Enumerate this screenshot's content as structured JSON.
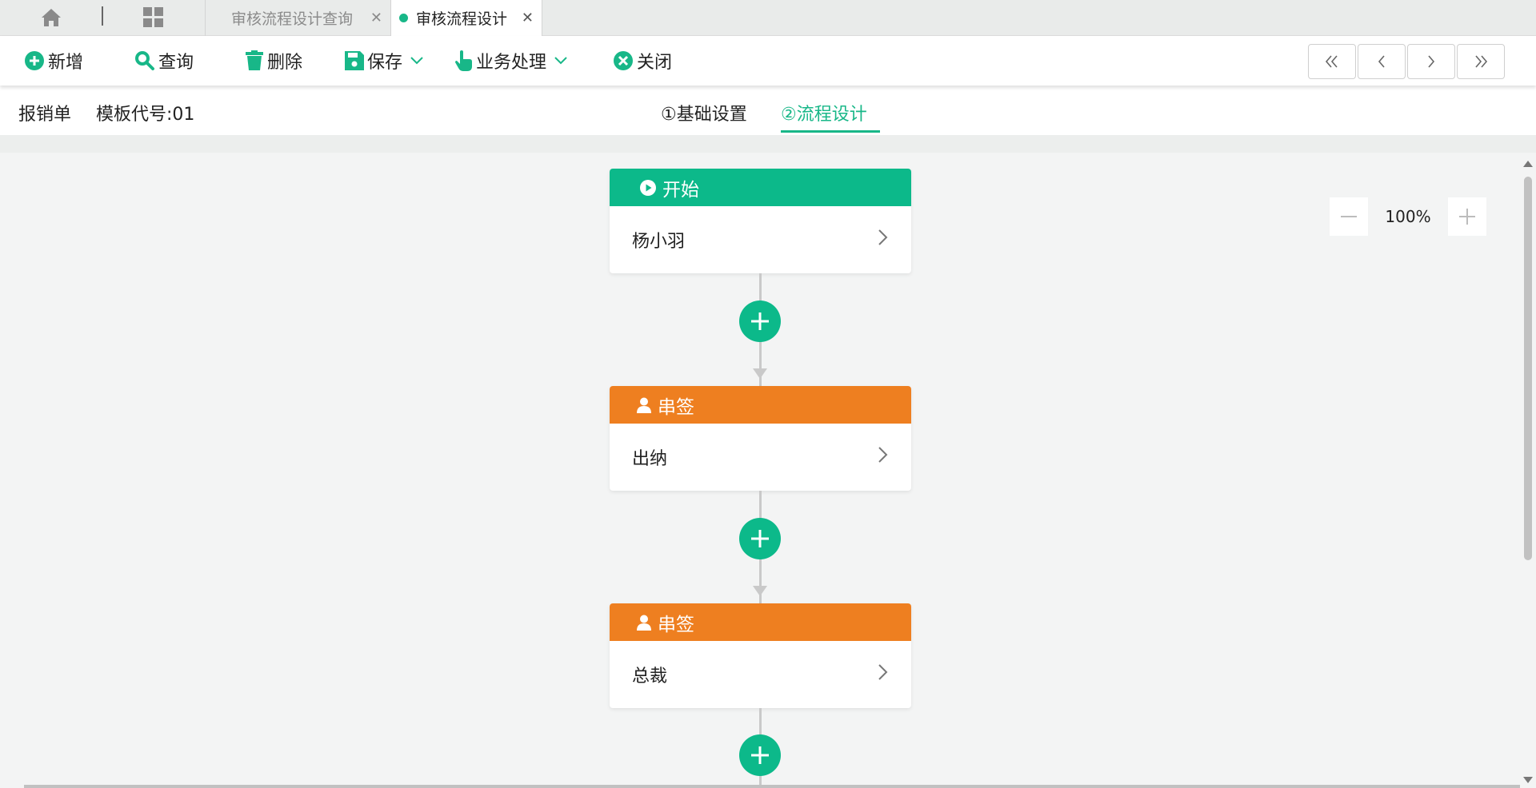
{
  "tabs": [
    {
      "label": "审核流程设计查询",
      "active": false
    },
    {
      "label": "审核流程设计",
      "active": true
    }
  ],
  "toolbar": {
    "add": "新增",
    "query": "查询",
    "delete": "删除",
    "save": "保存",
    "business": "业务处理",
    "close": "关闭"
  },
  "info": {
    "doc_type": "报销单",
    "template_code": "模板代号:01"
  },
  "steps": [
    {
      "label": "①基础设置",
      "active": false
    },
    {
      "label": "②流程设计",
      "active": true
    }
  ],
  "zoom": {
    "value": "100%"
  },
  "flow": [
    {
      "type": "start",
      "title": "开始",
      "assignee": "杨小羽"
    },
    {
      "type": "sign",
      "title": "串签",
      "assignee": "出纳"
    },
    {
      "type": "sign",
      "title": "串签",
      "assignee": "总裁"
    }
  ],
  "colors": {
    "accent": "#18b788",
    "start_header": "#0cb98a",
    "sign_header": "#ee7f20"
  }
}
